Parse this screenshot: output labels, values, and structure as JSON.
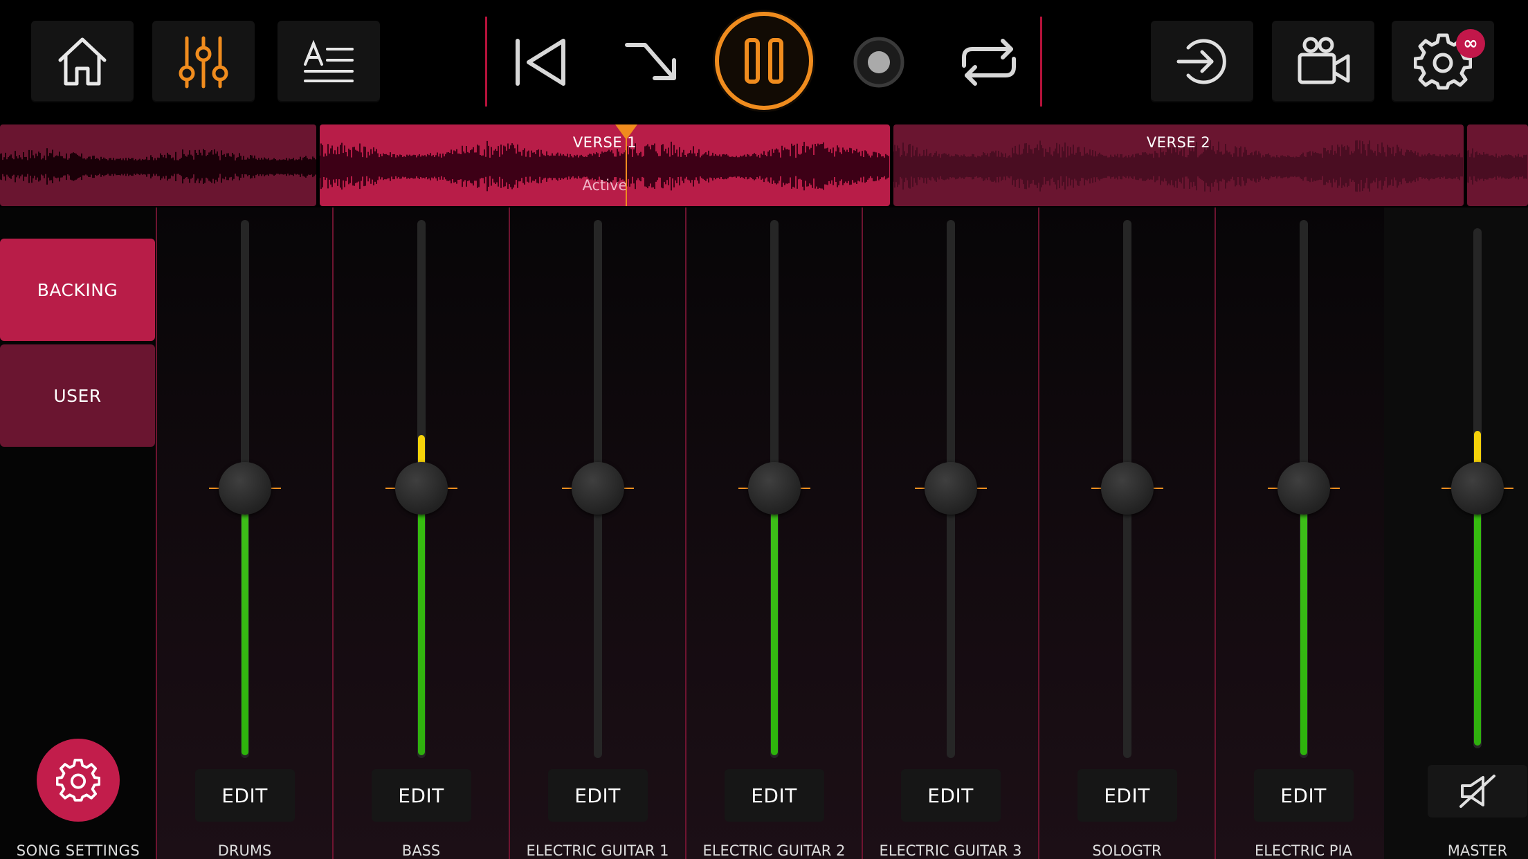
{
  "toolbar": {
    "icons": [
      "home-icon",
      "mixer-sliders-icon",
      "lyrics-text-icon",
      "skip-back-icon",
      "auto-jump-arrow-icon",
      "pause-icon",
      "record-icon",
      "loop-icon",
      "sign-in-icon",
      "video-camera-icon",
      "gear-icon"
    ],
    "settings_badge": "∞"
  },
  "timeline": {
    "sections": [
      {
        "label": "",
        "sub": "",
        "active": false
      },
      {
        "label": "VERSE 1",
        "sub": "Active",
        "active": true
      },
      {
        "label": "VERSE 2",
        "sub": "",
        "active": false
      },
      {
        "label": "",
        "sub": "",
        "active": false
      }
    ]
  },
  "side": {
    "tabs": [
      {
        "label": "BACKING",
        "selected": true
      },
      {
        "label": "USER",
        "selected": false
      }
    ],
    "song_settings_label": "SONG SETTINGS"
  },
  "mixer": {
    "edit_label": "EDIT",
    "channels": [
      {
        "name": "DRUMS",
        "fader": 0.5,
        "level": 0.5,
        "peak": false
      },
      {
        "name": "BASS",
        "fader": 0.5,
        "level": 0.6,
        "peak": true
      },
      {
        "name": "ELECTRIC GUITAR 1",
        "fader": 0.5,
        "level": 0,
        "peak": false
      },
      {
        "name": "ELECTRIC GUITAR 2",
        "fader": 0.5,
        "level": 0.5,
        "peak": false
      },
      {
        "name": "ELECTRIC GUITAR 3",
        "fader": 0.5,
        "level": 0,
        "peak": false
      },
      {
        "name": "SOLOGTR",
        "fader": 0.5,
        "level": 0,
        "peak": false
      },
      {
        "name": "ELECTRIC PIA",
        "fader": 0.5,
        "level": 0.5,
        "peak": false
      }
    ],
    "master": {
      "name": "MASTER",
      "fader": 0.5,
      "level": 0.61,
      "peak": true,
      "mute_icon": "speaker-muted-icon"
    }
  },
  "colors": {
    "accent": "#f08c1e",
    "crimson": "#c21d4b",
    "section_inactive": "#6a1530",
    "section_active": "#b81d48",
    "meter_green": "#3fc01a",
    "meter_yellow": "#f5d20a"
  }
}
